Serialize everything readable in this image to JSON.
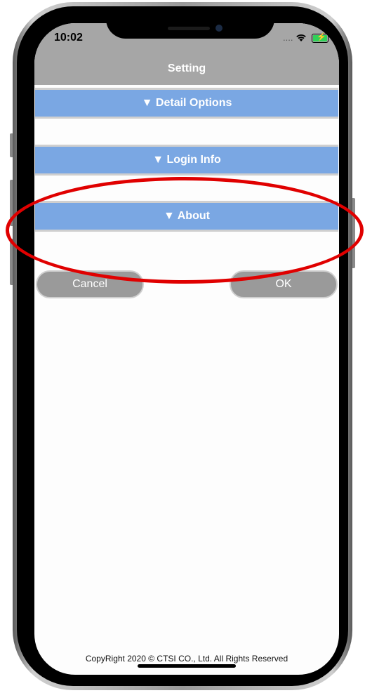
{
  "status_bar": {
    "time": "10:02",
    "signal": "....",
    "wifi_icon": "wifi-icon",
    "battery_icon": "battery-charging-icon"
  },
  "header": {
    "title": "Setting"
  },
  "sections": [
    {
      "label": "▼ Detail Options"
    },
    {
      "label": "▼ Login Info"
    },
    {
      "label": "▼ About"
    }
  ],
  "buttons": {
    "cancel": "Cancel",
    "ok": "OK"
  },
  "footer": {
    "copyright": "CopyRight 2020 © CTSI CO., Ltd. All Rights Reserved"
  },
  "colors": {
    "header_bg": "#a6a6a6",
    "section_bg": "#7aa7e3",
    "button_bg": "#9a9a9a",
    "annotation": "#e00000"
  }
}
